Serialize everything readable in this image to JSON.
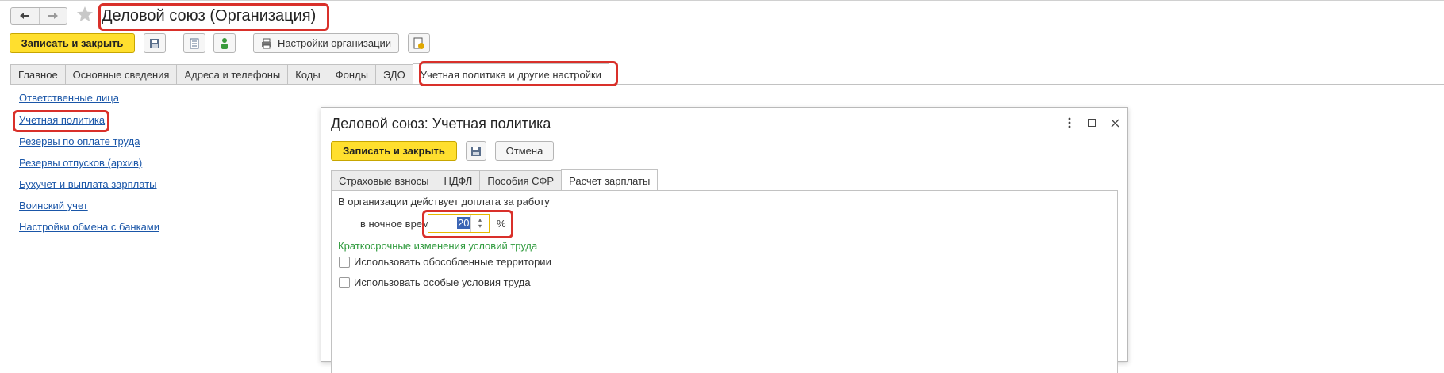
{
  "window": {
    "title": "Деловой союз (Организация)"
  },
  "toolbar": {
    "save_close_label": "Записать и закрыть",
    "org_settings_label": "Настройки организации"
  },
  "tabs": [
    {
      "label": "Главное"
    },
    {
      "label": "Основные сведения"
    },
    {
      "label": "Адреса и телефоны"
    },
    {
      "label": "Коды"
    },
    {
      "label": "Фонды"
    },
    {
      "label": "ЭДО"
    },
    {
      "label": "Учетная политика и другие настройки"
    }
  ],
  "sidebar": {
    "links": [
      {
        "label": "Ответственные лица"
      },
      {
        "label": "Учетная политика"
      },
      {
        "label": "Резервы по оплате труда"
      },
      {
        "label": "Резервы отпусков (архив)"
      },
      {
        "label": "Бухучет и выплата зарплаты"
      },
      {
        "label": "Воинский учет"
      },
      {
        "label": "Настройки обмена с банками"
      }
    ]
  },
  "dialog": {
    "title": "Деловой союз: Учетная политика",
    "save_close_label": "Записать и закрыть",
    "cancel_label": "Отмена",
    "tabs": [
      {
        "label": "Страховые взносы"
      },
      {
        "label": "НДФЛ"
      },
      {
        "label": "Пособия СФР"
      },
      {
        "label": "Расчет зарплаты"
      }
    ],
    "content": {
      "heading": "В организации действует доплата за работу",
      "night_label": "в ночное время:",
      "night_value": "20",
      "percent": "%",
      "short_term_link": "Краткосрочные изменения условий труда",
      "checkbox1": "Использовать обособленные территории",
      "checkbox2": "Использовать особые условия труда"
    }
  },
  "colors": {
    "accent_yellow": "#ffdf2e",
    "highlight_red": "#d9302a",
    "link_blue": "#1a56a8",
    "green_text": "#2e9a3c"
  }
}
